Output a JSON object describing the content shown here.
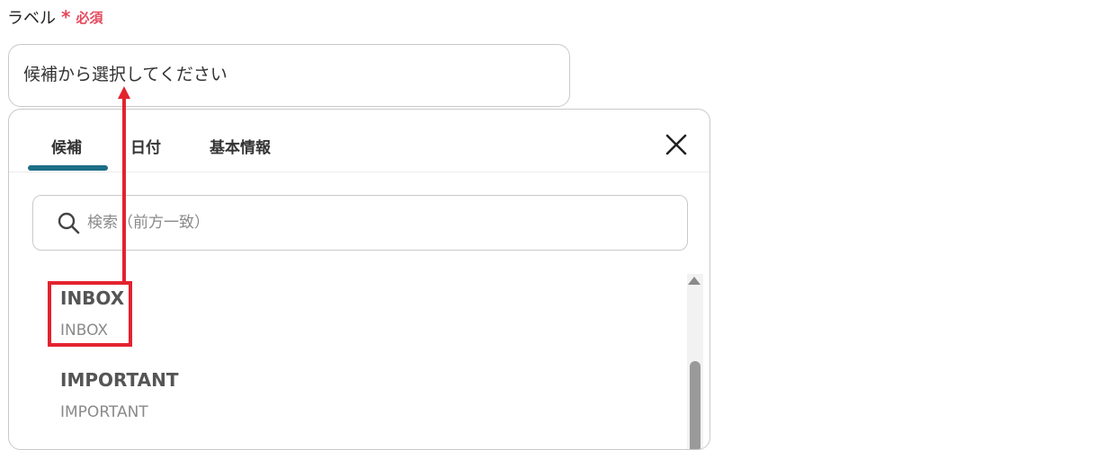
{
  "field": {
    "label": "ラベル",
    "required_mark": "*",
    "required_text": "必須",
    "placeholder": "候補から選択してください"
  },
  "dropdown": {
    "tabs": [
      {
        "label": "候補",
        "active": true
      },
      {
        "label": "日付",
        "active": false
      },
      {
        "label": "基本情報",
        "active": false
      }
    ],
    "search_placeholder": "検索（前方一致）",
    "items": [
      {
        "title": "INBOX",
        "subtitle": "INBOX"
      },
      {
        "title": "IMPORTANT",
        "subtitle": "IMPORTANT"
      }
    ]
  },
  "colors": {
    "required": "#e5485d",
    "tab_active_underline": "#1e6e86",
    "annotation": "#e3232f"
  },
  "icons": [
    "close-icon",
    "search-icon",
    "scroll-up-arrow-icon"
  ]
}
